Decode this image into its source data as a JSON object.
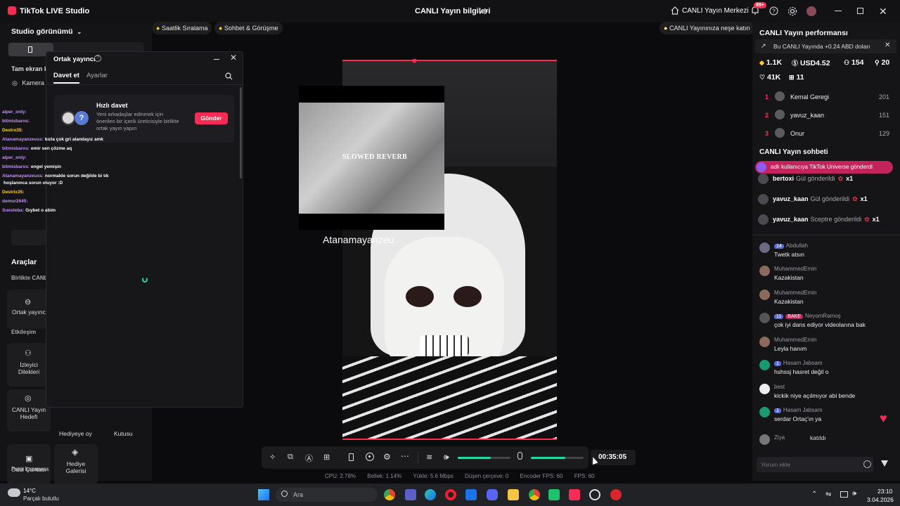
{
  "titlebar": {
    "app_title": "TikTok LIVE Studio",
    "center_title": "CANLI Yayın bilgileri",
    "live_center": "CANLI Yayın Merkezi",
    "notif_badge": "99+"
  },
  "left": {
    "studio_view": "Studio görünümü",
    "fullscreen_label": "Tam ekran k",
    "camera_label": "Kamera",
    "tools_title": "Araçlar",
    "together_label": "Birlikte CANL",
    "cohost_label": "Ortak yayıncı",
    "interaction_label": "Etkileşim",
    "viewer_wishes": "İzleyici Dilekleri",
    "live_goal": "CANLI Yayın Hedefi",
    "gift_poll": "Hediyeye oy",
    "box_label": "Kutusu",
    "reward_bag": "Ödül Çantası",
    "gift_gallery": "Hediye Galerisi",
    "monetization": "Para kazanma"
  },
  "dialog": {
    "title": "Ortak yayıncı",
    "tab_invite": "Davet et",
    "tab_settings": "Ayarlar",
    "quick_invite_title": "Hızlı davet",
    "quick_invite_desc": "Yeni arkadaşlar edinmek için önerilen bir içerik üreticisiyle birlikte ortak yayın yapın",
    "send_button": "Gönder"
  },
  "overlay_chat": [
    {
      "user": "alper_only:",
      "text": "",
      "color": "#c48cff"
    },
    {
      "user": "bitmisbaros:",
      "text": "",
      "color": "#c48cff"
    },
    {
      "user": "Destrx35:",
      "text": "",
      "color": "#ffcc33"
    },
    {
      "user": "Atanamayanzeuss:",
      "text": "kızla çok gri alandayız amk",
      "color": "#c48cff"
    },
    {
      "user": "bitmisbaros:",
      "text": "emir sen çözme aq",
      "color": "#c48cff"
    },
    {
      "user": "alper_only:",
      "text": "",
      "color": "#c48cff"
    },
    {
      "user": "bitmisbaros:",
      "text": "engel yemişin",
      "color": "#c48cff"
    },
    {
      "user": "Atanamayanzeuss:",
      "text": "normalde sorun değilde bi tık",
      "color": "#c48cff"
    },
    {
      "user": "",
      "text": "hoşlanınca sorun oluyor :D",
      "color": "#fff"
    },
    {
      "user": "Destrix35:",
      "text": "",
      "color": "#ffcc33"
    },
    {
      "user": "demur2645:",
      "text": "",
      "color": "#c48cff"
    },
    {
      "user": "Suesteba:",
      "text": "Gıybet o abim",
      "color": "#c48cff"
    }
  ],
  "center": {
    "pill_ranking": "Saatlik Sıralama",
    "pill_chat": "Sohbet & Görüşme",
    "pill_right": "CANLI Yayınınıza neşe katın",
    "video_text": "SLOWED REVERB",
    "overlay_name": "Atanamayanzeu",
    "timer": "00:35:05",
    "mic_level": 0.65,
    "speaker_level": 0.62
  },
  "status_bar": {
    "cpu": "CPU:  2.78%",
    "memory": "Bellek:  1.14%",
    "upload": "Yükle:  5.6 Mbps",
    "dropped": "Düşen çerçeve:  0",
    "encoder_fps": "Encoder FPS:  60",
    "fps": "FPS:  60"
  },
  "right": {
    "perf_title": "CANLI Yayın performansı",
    "banner": "Bu CANLI Yayında +0.24 ABD doları",
    "stat_diamonds": "1.1K",
    "stat_usd": "USD4.52",
    "stat_viewers": "154",
    "stat_new": "20",
    "stat_likes": "41K",
    "stat_gifts": "11",
    "ranking": [
      {
        "rank": "1",
        "name": "Kemal Geregi",
        "score": "201"
      },
      {
        "rank": "2",
        "name": "yavuz_kaan",
        "score": "151"
      },
      {
        "rank": "3",
        "name": "Onur",
        "score": "129"
      }
    ],
    "chat_title": "CANLI Yayın sohbeti",
    "universe_banner": "adlı kullanıcıya TikTok Universe gönderdi",
    "gifts": [
      {
        "name": "bertoxi",
        "action": "Gül gönderildi",
        "count": "x1"
      },
      {
        "name": "yavuz_kaan",
        "action": "Gül gönderildi",
        "count": "x1"
      },
      {
        "name": "yavuz_kaan",
        "action": "Sceptre gönderildi",
        "count": "x1"
      }
    ],
    "messages": [
      {
        "badge": "14",
        "user": "Abdullah",
        "text": "Twetk atsın",
        "avatar": "#6a6a80"
      },
      {
        "badge": "",
        "user": "MuhammedEmin",
        "text": "Kazakistan",
        "avatar": "#8a6a5a"
      },
      {
        "badge": "",
        "user": "MuhammedEmin",
        "text": "Kazakistan",
        "avatar": "#8a6a5a"
      },
      {
        "badge": "11",
        "user": "NeyomRamoş",
        "text": "çok iyi dans ediyor videolarına bak",
        "avatar": "#555"
      },
      {
        "badge": "",
        "user": "MuhammedEmin",
        "text": "Leyla hanım",
        "avatar": "#8a6a5a"
      },
      {
        "badge": "1",
        "user": "Hasam Jabsam",
        "text": "hshssj hasret değil o",
        "avatar": "#1a9a70"
      },
      {
        "badge": "",
        "user": "best",
        "text": "kickik niye açılmıyor abi bende",
        "avatar": "#eeeeee"
      },
      {
        "badge": "1",
        "user": "Hasam Jabsam",
        "text": "serdar Ortaç'ın ya",
        "avatar": "#1a9a70"
      },
      {
        "badge": "",
        "user": "Ziya",
        "text": "katıldı",
        "avatar": "#777"
      }
    ],
    "bake_badge": "BAKE",
    "comment_placeholder": "Yorum ekle"
  },
  "taskbar": {
    "weather_temp": "14°C",
    "weather_desc": "Parçalı bulutlu",
    "search": "Ara",
    "time": "23:10",
    "date": "3.04.2026"
  },
  "colors": {
    "accent": "#fe2c55",
    "green": "#25d8a6",
    "brand_purple": "#8b5cf6"
  }
}
